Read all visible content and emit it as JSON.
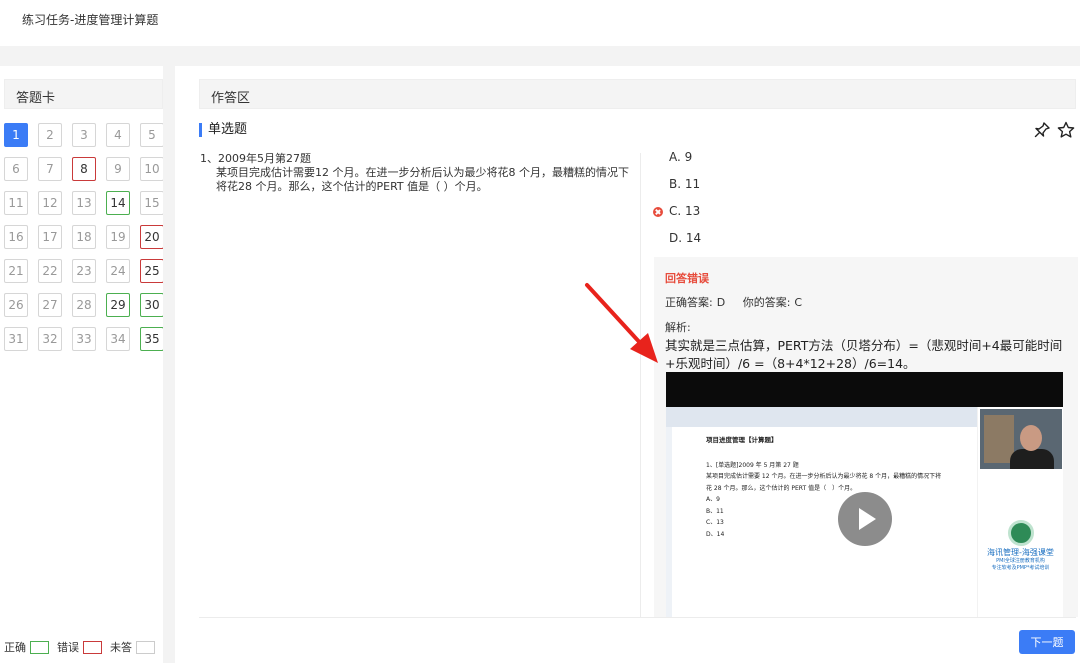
{
  "header": {
    "title": "练习任务-进度管理计算题"
  },
  "answer_card": {
    "title": "答题卡",
    "questions": [
      {
        "n": "1",
        "state": "active"
      },
      {
        "n": "2",
        "state": "none"
      },
      {
        "n": "3",
        "state": "none"
      },
      {
        "n": "4",
        "state": "none"
      },
      {
        "n": "5",
        "state": "none"
      },
      {
        "n": "6",
        "state": "none"
      },
      {
        "n": "7",
        "state": "none"
      },
      {
        "n": "8",
        "state": "wrong"
      },
      {
        "n": "9",
        "state": "none"
      },
      {
        "n": "10",
        "state": "none"
      },
      {
        "n": "11",
        "state": "none"
      },
      {
        "n": "12",
        "state": "none"
      },
      {
        "n": "13",
        "state": "none"
      },
      {
        "n": "14",
        "state": "right"
      },
      {
        "n": "15",
        "state": "none"
      },
      {
        "n": "16",
        "state": "none"
      },
      {
        "n": "17",
        "state": "none"
      },
      {
        "n": "18",
        "state": "none"
      },
      {
        "n": "19",
        "state": "none"
      },
      {
        "n": "20",
        "state": "wrong"
      },
      {
        "n": "21",
        "state": "none"
      },
      {
        "n": "22",
        "state": "none"
      },
      {
        "n": "23",
        "state": "none"
      },
      {
        "n": "24",
        "state": "none"
      },
      {
        "n": "25",
        "state": "wrong"
      },
      {
        "n": "26",
        "state": "none"
      },
      {
        "n": "27",
        "state": "none"
      },
      {
        "n": "28",
        "state": "none"
      },
      {
        "n": "29",
        "state": "right"
      },
      {
        "n": "30",
        "state": "right"
      },
      {
        "n": "31",
        "state": "none"
      },
      {
        "n": "32",
        "state": "none"
      },
      {
        "n": "33",
        "state": "none"
      },
      {
        "n": "34",
        "state": "none"
      },
      {
        "n": "35",
        "state": "right"
      }
    ],
    "legend": {
      "correct": "正确",
      "wrong": "错误",
      "unanswered": "未答"
    }
  },
  "answer_area": {
    "title": "作答区",
    "question_type": "单选题",
    "question": {
      "header": "1、2009年5月第27题",
      "body": "某项目完成估计需要12 个月。在进一步分析后认为最少将花8 个月，最糟糕的情况下将花28 个月。那么，这个估计的PERT 值是（ ）个月。"
    },
    "options": [
      "A. 9",
      "B. 11",
      "C. 13",
      "D. 14"
    ],
    "selected_option": "C. 13",
    "result": {
      "status": "回答错误",
      "correct_label": "正确答案:",
      "correct_value": "D",
      "your_label": "你的答案:",
      "your_value": "C",
      "analysis_label": "解析:",
      "explanation": "其实就是三点估算，PERT方法（贝塔分布）=（悲观时间+4最可能时间+乐观时间）/6 =（8+4*12+28）/6=14。"
    },
    "video": {
      "doc_title": "项目进度管理【计算题】",
      "doc_q": "1、[单选题]2009 年 5 月第 27 题",
      "doc_body1": "某项目完成估计需要 12 个月。在进一步分析后认为最少将花 8 个月，最糟糕的情况下将",
      "doc_body2": "花 28 个月。那么，这个估计的 PERT 值是（　）个月。",
      "doc_options": [
        "A、9",
        "B、11",
        "C、13",
        "D、14"
      ],
      "brand": "海讯管理-海强课堂",
      "brand_sub1": "PMI全球注册教育机构",
      "brand_sub2": "专注软考及PMP*考试培训"
    },
    "next_button": "下一题"
  },
  "colors": {
    "accent": "#3b7cf6",
    "wrong": "#c93a3a",
    "correct": "#4caf50",
    "error_text": "#e74c3c"
  },
  "icons": {
    "pin": "pin-icon",
    "favorite": "star-icon",
    "wrong_mark": "x-circle-icon",
    "play": "play-icon"
  }
}
